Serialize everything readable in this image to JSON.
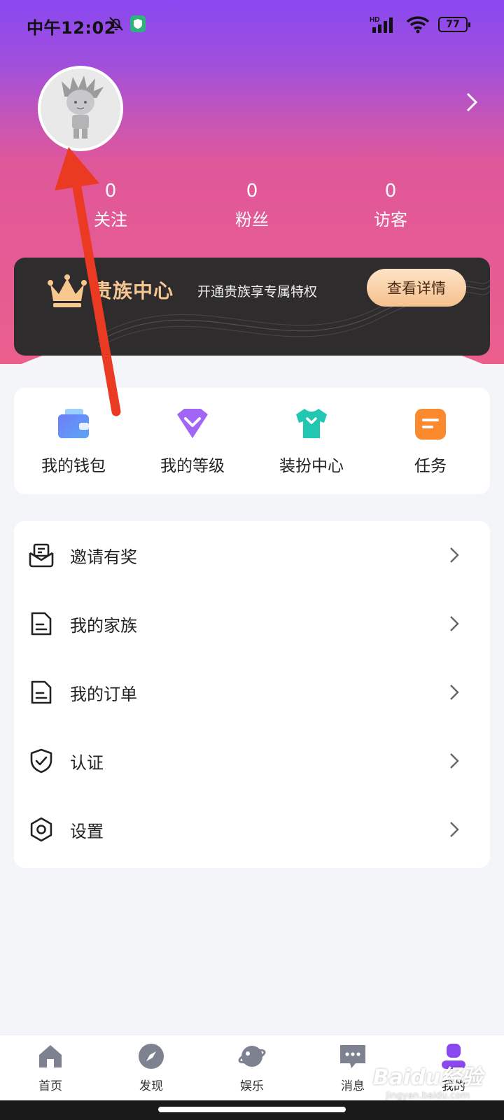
{
  "status_bar": {
    "time": "中午12:02",
    "network_label": "HD",
    "battery": "77"
  },
  "profile": {
    "stats": [
      {
        "value": "0",
        "label": "关注"
      },
      {
        "value": "0",
        "label": "粉丝"
      },
      {
        "value": "0",
        "label": "访客"
      }
    ]
  },
  "noble_banner": {
    "title": "贵族中心",
    "subtitle": "开通贵族享专属特权",
    "button": "查看详情"
  },
  "quick_actions": [
    {
      "label": "我的钱包",
      "icon": "wallet-icon"
    },
    {
      "label": "我的等级",
      "icon": "level-gem-icon"
    },
    {
      "label": "装扮中心",
      "icon": "tshirt-icon"
    },
    {
      "label": "任务",
      "icon": "task-icon"
    }
  ],
  "menu": [
    {
      "label": "邀请有奖",
      "icon": "invite-mail-icon"
    },
    {
      "label": "我的家族",
      "icon": "document-icon"
    },
    {
      "label": "我的订单",
      "icon": "document-icon"
    },
    {
      "label": "认证",
      "icon": "shield-check-icon"
    },
    {
      "label": "设置",
      "icon": "gear-icon"
    }
  ],
  "tab_bar": [
    {
      "label": "首页",
      "icon": "home-icon"
    },
    {
      "label": "发现",
      "icon": "compass-icon"
    },
    {
      "label": "娱乐",
      "icon": "planet-icon"
    },
    {
      "label": "消息",
      "icon": "chat-icon"
    },
    {
      "label": "我的",
      "icon": "person-icon",
      "active": true
    }
  ],
  "watermark": {
    "logo": "Baidu经验",
    "url": "jingyan.baidu.com"
  },
  "colors": {
    "accent_purple": "#8a48f0",
    "hero_pink": "#ea5f8c",
    "annotation_arrow": "#ea3a22",
    "noble_gold": "#f6c793"
  }
}
